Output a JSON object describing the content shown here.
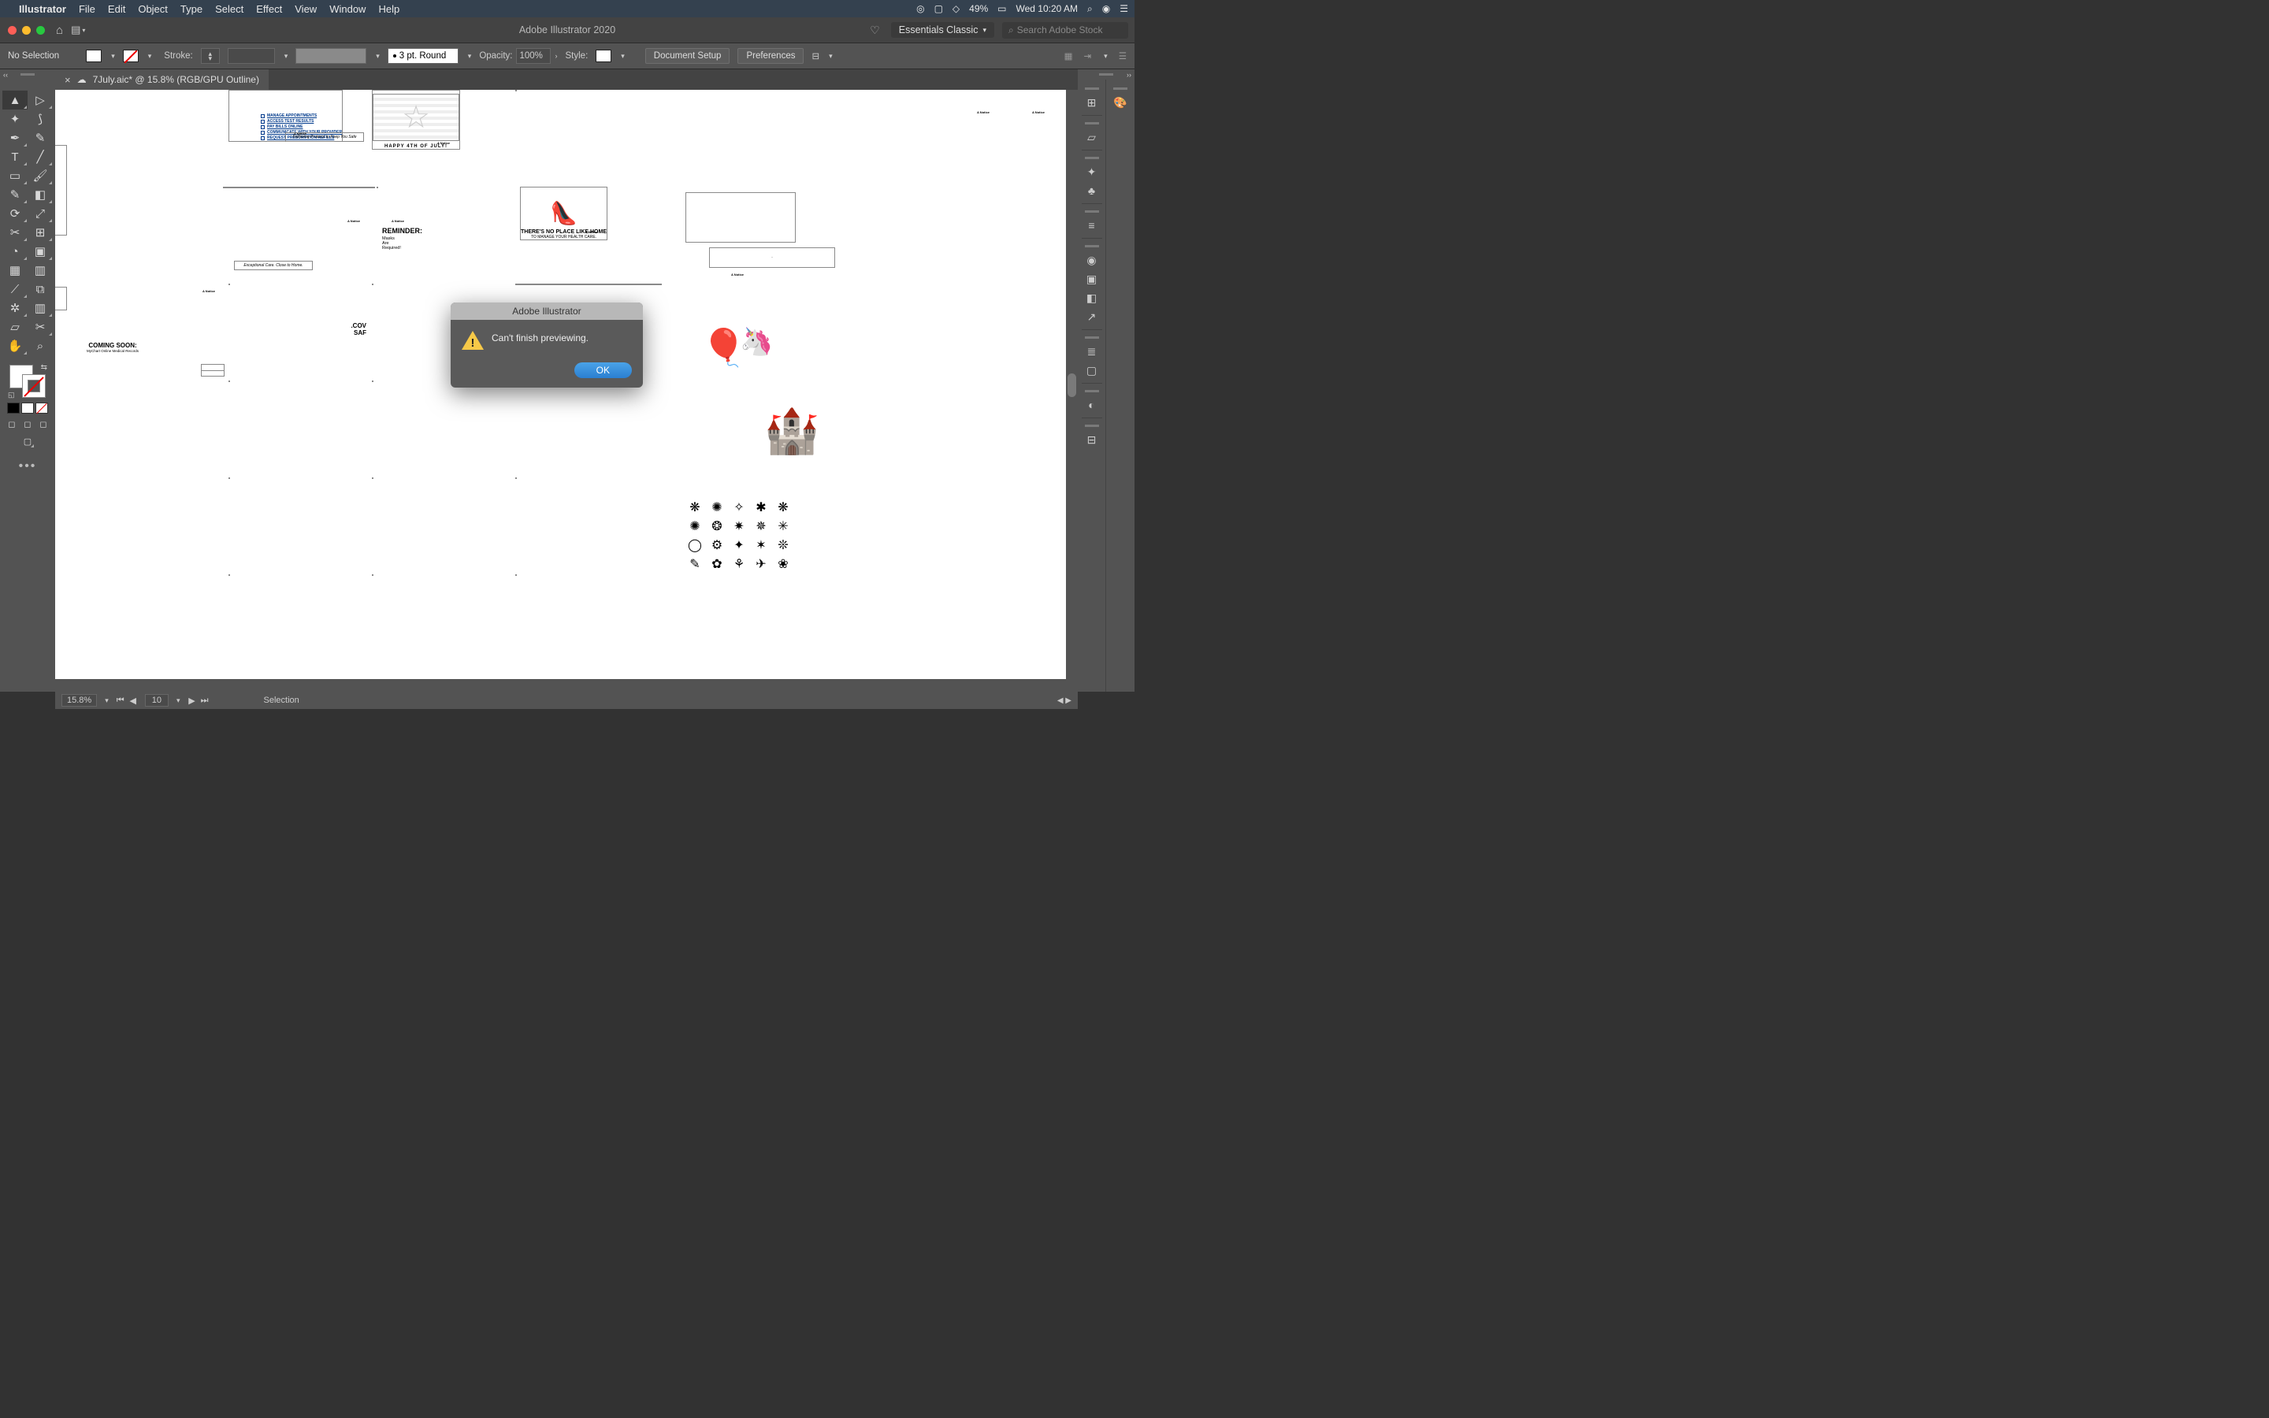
{
  "menubar": {
    "app": "Illustrator",
    "items": [
      "File",
      "Edit",
      "Object",
      "Type",
      "Select",
      "Effect",
      "View",
      "Window",
      "Help"
    ],
    "battery": "49%",
    "clock": "Wed 10:20 AM"
  },
  "titlebar": {
    "title": "Adobe Illustrator 2020",
    "workspace": "Essentials Classic",
    "stock_placeholder": "Search Adobe Stock"
  },
  "controlbar": {
    "selection": "No Selection",
    "stroke_label": "Stroke:",
    "brush": "3 pt. Round",
    "opacity_label": "Opacity:",
    "opacity_value": "100%",
    "style_label": "Style:",
    "doc_setup": "Document Setup",
    "prefs": "Preferences"
  },
  "doctab": {
    "label": "7July.aic* @ 15.8% (RGB/GPU Outline)"
  },
  "artboards": {
    "a1_lines": [
      "MANAGE APPOINTMENTS",
      "ACCESS TEST RESULTS",
      "PAY BILLS ONLINE",
      "COMMUNICATE WITH YOUR PROVIDER",
      "REQUEST PRESCRIPTION REFILLS"
    ],
    "a2_caption": "HAPPY 4TH OF JULY!",
    "a4_box": "Following Protocol to Keep You Safe",
    "a5_h": "REMINDER:",
    "a5_s": "Masks Are Required!",
    "a6_h": "THERE'S NO PLACE LIKE HOME",
    "a6_s": "TO MANAGE YOUR HEALTH CARE.",
    "a7_box": "Exceptional Care. Close to Home.",
    "a8_h": ".COV",
    "a8_s": "SAF",
    "coming_h": "COMING SOON:",
    "coming_s": "MyChart Online Medical Records",
    "notice": "A Notice"
  },
  "modal": {
    "title": "Adobe Illustrator",
    "message": "Can't finish previewing.",
    "ok": "OK"
  },
  "statusbar": {
    "zoom": "15.8%",
    "artboard": "10",
    "tool": "Selection"
  }
}
